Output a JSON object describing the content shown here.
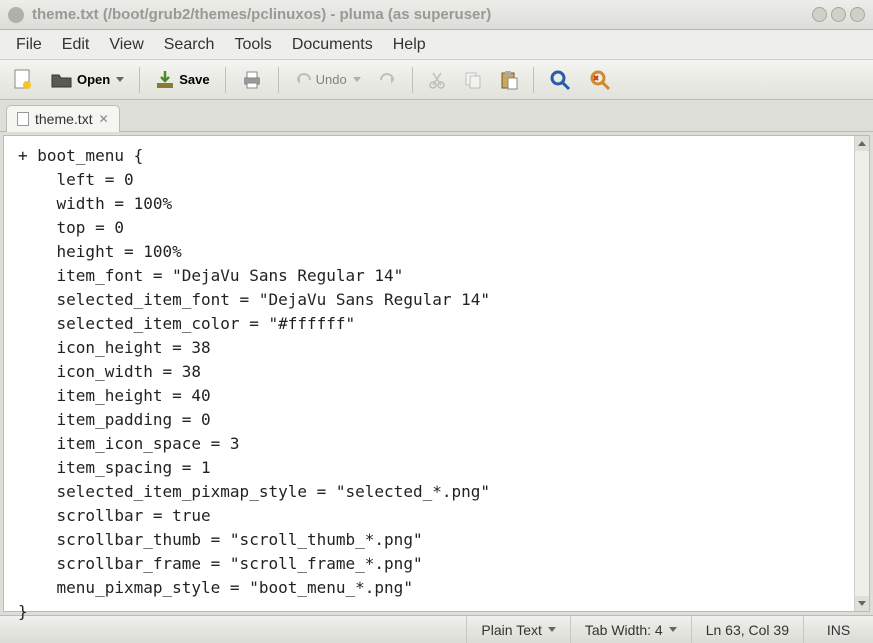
{
  "window": {
    "title": "theme.txt (/boot/grub2/themes/pclinuxos) - pluma (as superuser)"
  },
  "menubar": {
    "items": [
      "File",
      "Edit",
      "View",
      "Search",
      "Tools",
      "Documents",
      "Help"
    ]
  },
  "toolbar": {
    "open_label": "Open",
    "save_label": "Save",
    "undo_label": "Undo"
  },
  "tab": {
    "label": "theme.txt"
  },
  "editor": {
    "content": "+ boot_menu {\n    left = 0\n    width = 100%\n    top = 0\n    height = 100%\n    item_font = \"DejaVu Sans Regular 14\"\n    selected_item_font = \"DejaVu Sans Regular 14\"\n    selected_item_color = \"#ffffff\"\n    icon_height = 38\n    icon_width = 38\n    item_height = 40\n    item_padding = 0\n    item_icon_space = 3\n    item_spacing = 1\n    selected_item_pixmap_style = \"selected_*.png\"\n    scrollbar = true\n    scrollbar_thumb = \"scroll_thumb_*.png\"\n    scrollbar_frame = \"scroll_frame_*.png\"\n    menu_pixmap_style = \"boot_menu_*.png\"\n}"
  },
  "statusbar": {
    "syntax": "Plain Text",
    "tab_width": "Tab Width: 4",
    "position": "Ln 63, Col 39",
    "mode": "INS"
  }
}
